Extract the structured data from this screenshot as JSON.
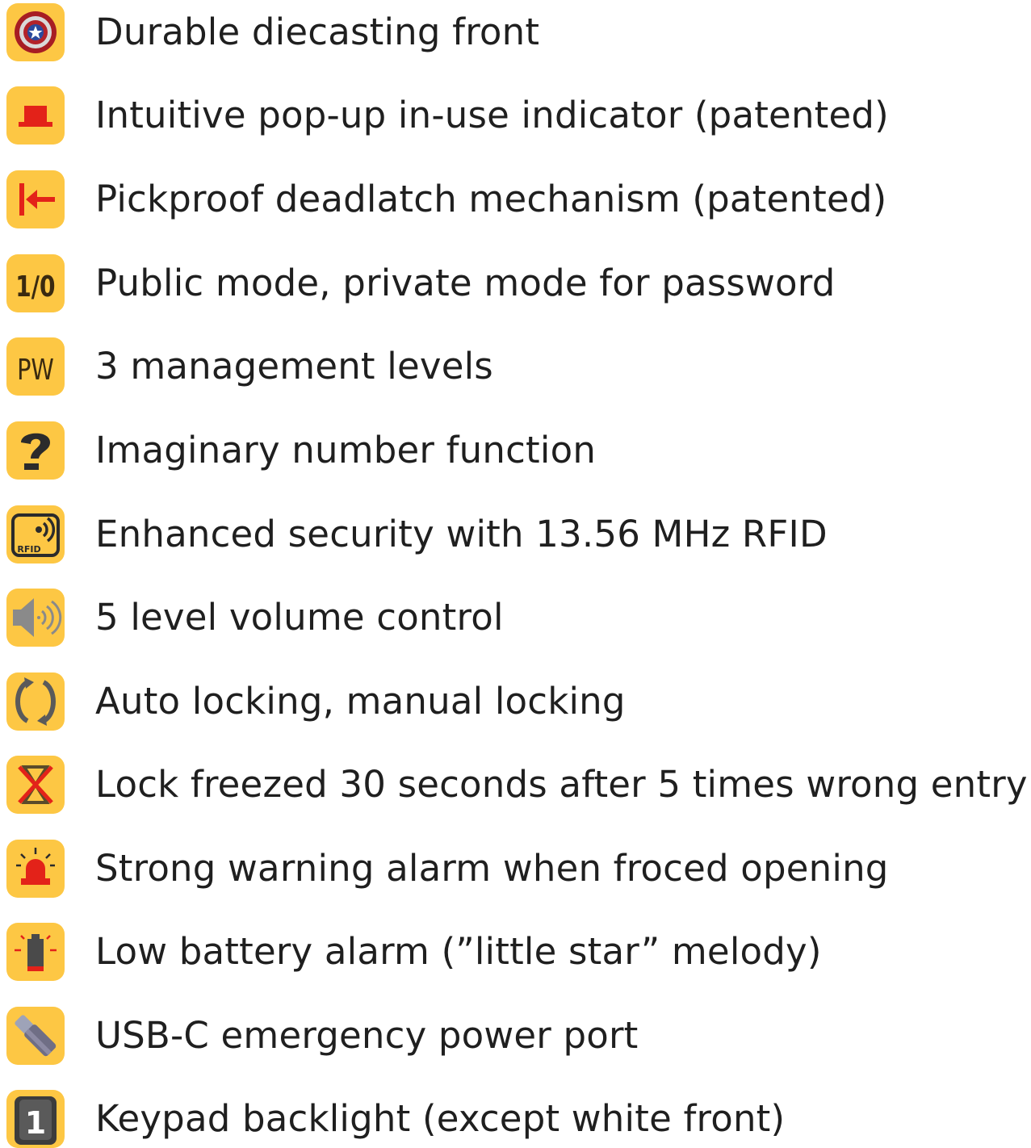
{
  "features": [
    {
      "icon": "shield-emblem-icon",
      "label": "Durable diecasting front"
    },
    {
      "icon": "pop-up-indicator-icon",
      "label": "Intuitive pop-up in-use indicator (patented)"
    },
    {
      "icon": "deadlatch-arrow-icon",
      "label": "Pickproof deadlatch mechanism (patented)"
    },
    {
      "icon": "mode-toggle-icon",
      "label": "Public mode, private mode for password",
      "icon_text": "1/0"
    },
    {
      "icon": "password-icon",
      "label": "3 management levels",
      "icon_text": "PW"
    },
    {
      "icon": "question-mark-icon",
      "label": "Imaginary number function"
    },
    {
      "icon": "rfid-icon",
      "label": "Enhanced security with 13.56 MHz RFID",
      "icon_text": "RFID"
    },
    {
      "icon": "speaker-volume-icon",
      "label": "5 level volume control"
    },
    {
      "icon": "rotate-arrows-icon",
      "label": "Auto locking, manual locking"
    },
    {
      "icon": "hourglass-crossed-icon",
      "label": "Lock freezed 30 seconds after 5 times wrong entry"
    },
    {
      "icon": "siren-alarm-icon",
      "label": "Strong warning alarm when froced opening"
    },
    {
      "icon": "low-battery-icon",
      "label": "Low battery alarm (”little star” melody)"
    },
    {
      "icon": "usb-c-plug-icon",
      "label": "USB-C emergency power port"
    },
    {
      "icon": "keypad-key-icon",
      "label": "Keypad backlight (except white front)",
      "icon_text": "1"
    }
  ],
  "colors": {
    "icon_tile": "#fdc744",
    "text": "#1f1f1f",
    "accent_red": "#e32219",
    "icon_dark": "#2b2b2b"
  }
}
